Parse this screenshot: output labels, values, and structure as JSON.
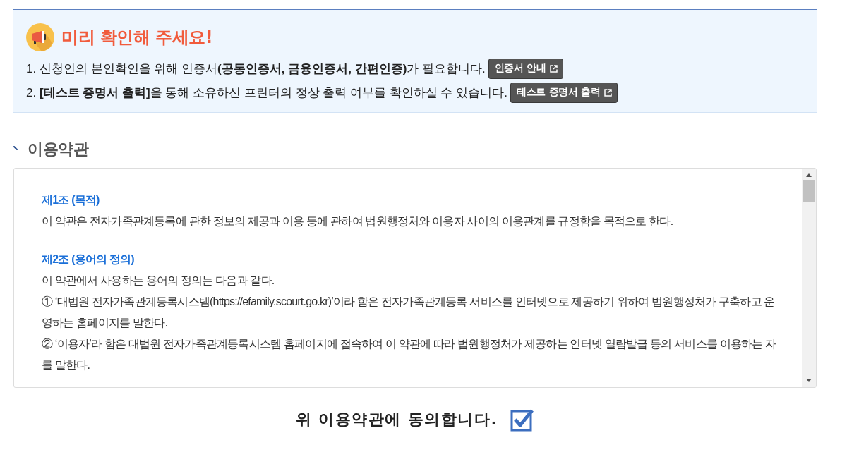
{
  "notice": {
    "title": "미리 확인해 주세요!",
    "items": [
      {
        "text": "1. 신청인의 본인확인을 위해 인증서**(공동인증서, 금융인증서, 간편인증)**가 필요합니다.",
        "button": "인증서 안내"
      },
      {
        "text": "2. **[테스트 증명서 출력]**을 통해 소유하신 프린터의 정상 출력 여부를 확인하실 수 있습니다.",
        "button": "테스트 증명서 출력"
      }
    ]
  },
  "terms": {
    "title": "이용약관",
    "articles": [
      {
        "heading": "제1조 (목적)",
        "paragraphs": [
          "이 약관은 전자가족관계등록에 관한 정보의 제공과 이용 등에 관하여 법원행정처와 이용자 사이의 이용관계를 규정함을 목적으로 한다."
        ]
      },
      {
        "heading": "제2조 (용어의 정의)",
        "paragraphs": [
          "이 약관에서 사용하는 용어의 정의는 다음과 같다.",
          "① ‘대법원 전자가족관계등록시스템(https://efamily.scourt.go.kr)’이라 함은 전자가족관계등록 서비스를 인터넷으로 제공하기 위하여 법원행정처가 구축하고 운영하는 홈페이지를 말한다.",
          "② ‘이용자’라 함은 대법원 전자가족관계등록시스템 홈페이지에 접속하여 이 약관에 따라 법원행정처가 제공하는 인터넷 열람발급 등의 서비스를 이용하는 자를 말한다."
        ]
      }
    ]
  },
  "agreement": {
    "label": "위 이용약관에 동의합니다.",
    "checked": true
  }
}
